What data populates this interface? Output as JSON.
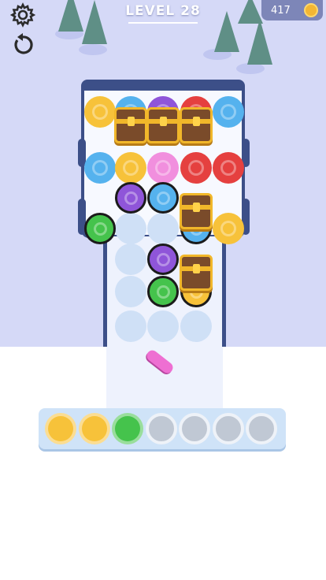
{
  "hud": {
    "level_label": "LEVEL 28",
    "coins": "417",
    "settings_icon": "gear-icon",
    "restart_icon": "restart-icon",
    "coin_icon": "coin-icon"
  },
  "colors": {
    "yellow": "#f7c23a",
    "blue": "#55b2ee",
    "purple": "#8f55d9",
    "red": "#e5403f",
    "pink": "#f18fde",
    "green": "#45c34c",
    "empty": "#c0c8d4"
  },
  "board_chips": [
    {
      "row": 1,
      "col": 1,
      "color": "yellow",
      "outlined": false
    },
    {
      "row": 1,
      "col": 2,
      "color": "blue",
      "outlined": false
    },
    {
      "row": 1,
      "col": 3,
      "color": "purple",
      "outlined": false
    },
    {
      "row": 1,
      "col": 4,
      "color": "red",
      "outlined": false
    },
    {
      "row": 1,
      "col": 5,
      "color": "blue",
      "outlined": false
    },
    {
      "row": 2,
      "col": 1,
      "color": "blue",
      "outlined": false
    },
    {
      "row": 2,
      "col": 2,
      "color": "yellow",
      "outlined": false
    },
    {
      "row": 2,
      "col": 3,
      "color": "pink",
      "outlined": false
    },
    {
      "row": 2,
      "col": 4,
      "color": "red",
      "outlined": false
    },
    {
      "row": 2,
      "col": 5,
      "color": "red",
      "outlined": false
    },
    {
      "row": 3,
      "col": 2,
      "color": "purple",
      "outlined": true
    },
    {
      "row": 3,
      "col": 3,
      "color": "blue",
      "outlined": true
    },
    {
      "row": 4,
      "col": 1,
      "color": "green",
      "outlined": true
    },
    {
      "row": 4,
      "col": 4,
      "color": "blue",
      "outlined": true
    },
    {
      "row": 4,
      "col": 5,
      "color": "yellow",
      "outlined": false
    },
    {
      "row": 5,
      "col": 3,
      "color": "purple",
      "outlined": true
    },
    {
      "row": 6,
      "col": 3,
      "color": "green",
      "outlined": true
    },
    {
      "row": 6,
      "col": 4,
      "color": "yellow",
      "outlined": true
    }
  ],
  "chests": [
    {
      "row": 1,
      "col": 2
    },
    {
      "row": 1,
      "col": 3
    },
    {
      "row": 1,
      "col": 4
    },
    {
      "row": 3,
      "col": 4
    },
    {
      "row": 5,
      "col": 4
    }
  ],
  "tray": [
    "yellow",
    "yellow",
    "green",
    "empty",
    "empty",
    "empty",
    "empty"
  ]
}
